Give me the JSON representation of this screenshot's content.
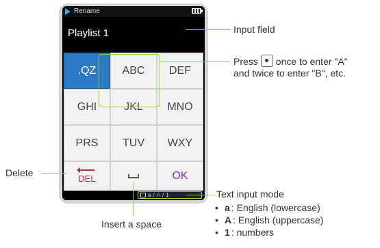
{
  "device": {
    "status_title": "Rename",
    "input_value": "Playlist 1",
    "keys": [
      ".QZ",
      "ABC",
      "DEF",
      "GHI",
      "JKL",
      "MNO",
      "PRS",
      "TUV",
      "WXY"
    ],
    "del_label": "DEL",
    "ok_label": "OK",
    "mode_indicator": {
      "lower": "a",
      "upper": "A",
      "num": "1",
      "sep": "/"
    }
  },
  "callouts": {
    "input_field": "Input field",
    "press_prefix": "Press",
    "press_suffix": "once to enter \"A\"",
    "press_line2": "and twice to enter \"B\", etc.",
    "delete": "Delete",
    "insert_space": "Insert a space",
    "text_input_mode": "Text input mode",
    "modes": [
      {
        "glyph": "a",
        "text": ": English (lowercase)"
      },
      {
        "glyph": "A",
        "text": ": English (uppercase)"
      },
      {
        "glyph": "1",
        "text": ": numbers"
      }
    ]
  },
  "colors": {
    "accent": "#8fd33a",
    "selected_key": "#2c79c6",
    "del": "#c0253f",
    "ok": "#8a2ac0"
  }
}
